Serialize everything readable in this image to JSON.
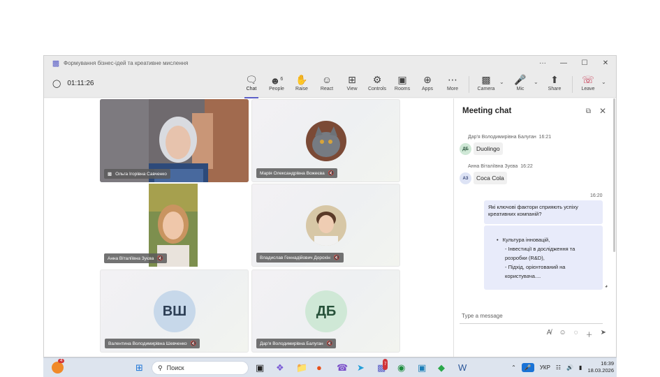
{
  "window": {
    "title": "Формування бізнес-ідей та креативне мислення",
    "controls": [
      "···",
      "—",
      "☐",
      "✕"
    ]
  },
  "toolbar": {
    "timer": "01:11:26",
    "chat": "Chat",
    "people": "People",
    "people_count": "6",
    "raise": "Raise",
    "react": "React",
    "view": "View",
    "controls": "Controls",
    "rooms": "Rooms",
    "apps": "Apps",
    "more": "More",
    "camera": "Camera",
    "mic": "Mic",
    "share": "Share",
    "leave": "Leave"
  },
  "tiles": [
    {
      "name": "Ольга Ігорівна Савченко"
    },
    {
      "name": "Марія Олександрівна Вожеєва"
    },
    {
      "name": "Анна Віталіївна Зуєва"
    },
    {
      "name": "Владислав Геннадійович Дорохін"
    },
    {
      "name": "Валентина Володимирівна Шевченко",
      "initials": "ВШ"
    },
    {
      "name": "Дар'я Володимирівна Балуган",
      "initials": "ДБ"
    }
  ],
  "chat": {
    "title": "Meeting chat",
    "messages": [
      {
        "author": "Дар'я Володимирівна Балуган",
        "time": "16:21",
        "initials": "ДБ",
        "text": "Duolingo"
      },
      {
        "author": "Анна Віталіївна Зуєва",
        "time": "16:22",
        "initials": "АЗ",
        "text": "Coca Cola"
      }
    ],
    "mine": {
      "time": "16:20",
      "question": "Які ключові фактори сприяють успіху креативних компаній?",
      "answer_bullet": "Культура інновацій,",
      "answer_line2": "- Інвестиції в дослідження та розробки (R&D),",
      "answer_line3": "- Підхід, орієнтований на користувача...."
    },
    "placeholder": "Type a message"
  },
  "taskbar": {
    "notification_count": "4",
    "search": "Поиск",
    "teams_badge": "7",
    "language": "УКР",
    "time": "16:39",
    "date": "18.03.2026"
  },
  "colors": {
    "accent": "#5b5fc7",
    "leave": "#c4314b",
    "mine_bubble": "#e8ebfa"
  }
}
